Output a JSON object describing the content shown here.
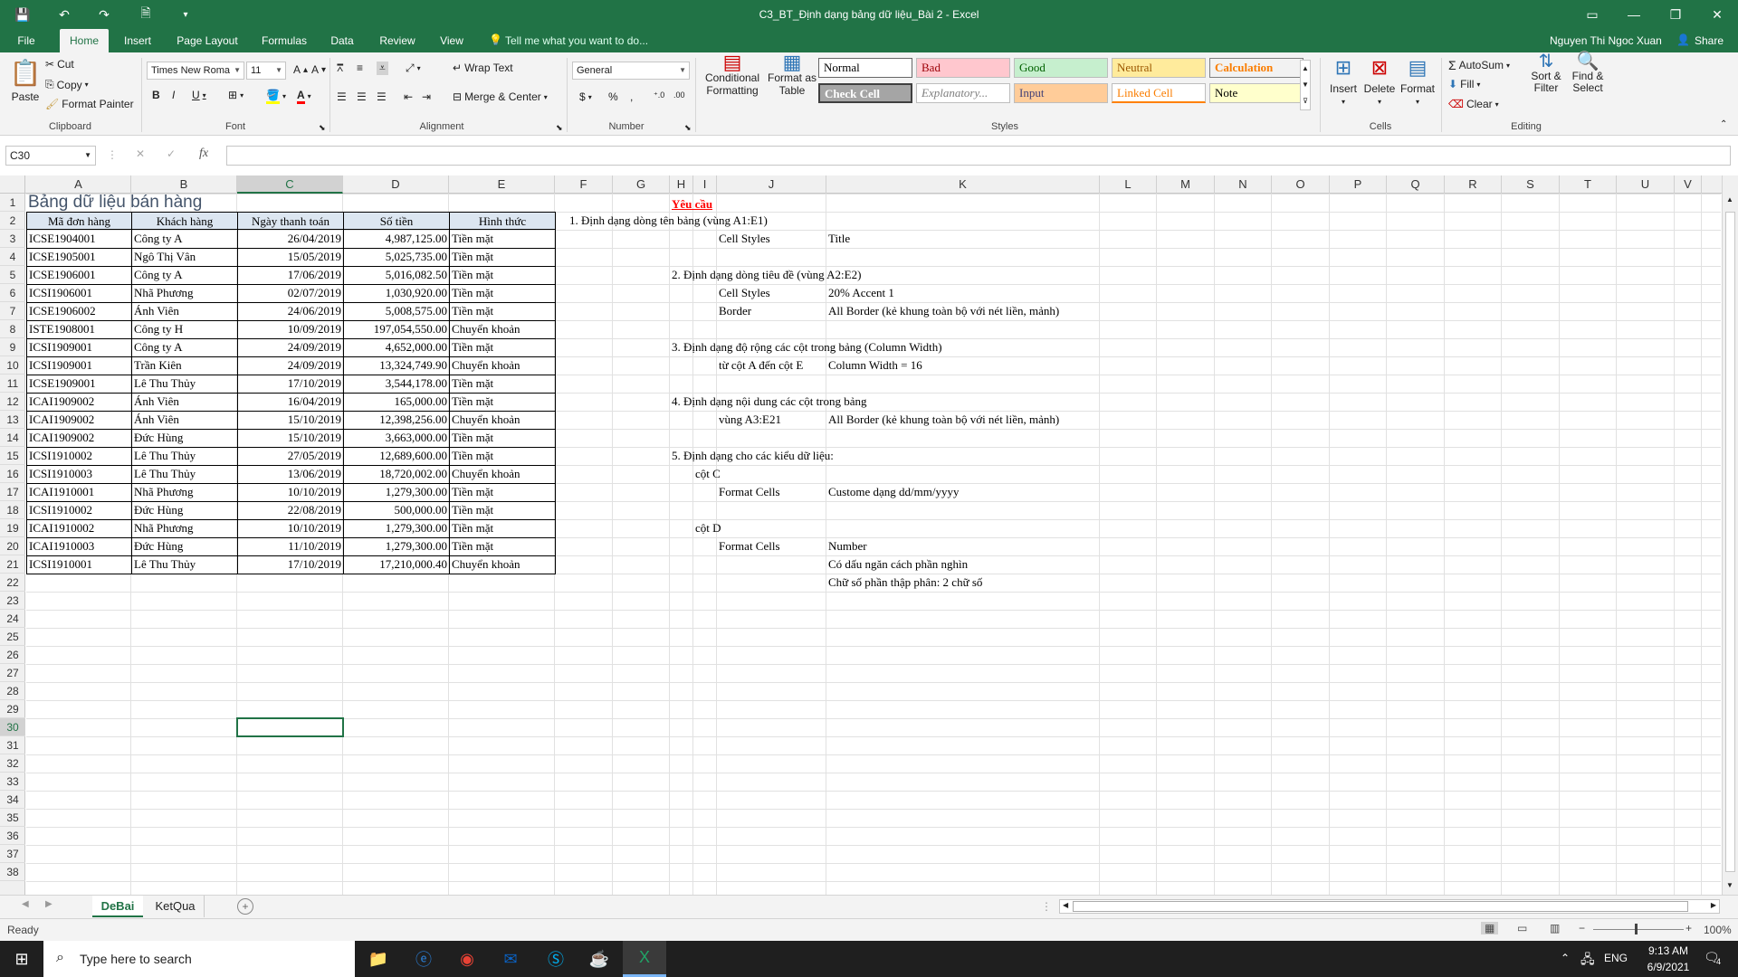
{
  "window": {
    "title": "C3_BT_Định dạng bảng dữ liệu_Bài 2 - Excel",
    "user": "Nguyen Thi Ngoc Xuan",
    "share_label": "Share"
  },
  "ribbon_tabs": [
    "File",
    "Home",
    "Insert",
    "Page Layout",
    "Formulas",
    "Data",
    "Review",
    "View"
  ],
  "tell_me": "Tell me what you want to do...",
  "clipboard": {
    "paste": "Paste",
    "cut": "Cut",
    "copy": "Copy",
    "format_painter": "Format Painter",
    "label": "Clipboard"
  },
  "font": {
    "name": "Times New Roma",
    "size": "11",
    "label": "Font"
  },
  "alignment": {
    "wrap": "Wrap Text",
    "merge": "Merge & Center",
    "label": "Alignment"
  },
  "number": {
    "format": "General",
    "label": "Number"
  },
  "styles": {
    "conditional": "Conditional Formatting",
    "format_table": "Format as Table",
    "label": "Styles",
    "cells": [
      {
        "t": "Normal",
        "bg": "#ffffff",
        "fg": "#000000"
      },
      {
        "t": "Bad",
        "bg": "#ffc7ce",
        "fg": "#9c0006"
      },
      {
        "t": "Good",
        "bg": "#c6efce",
        "fg": "#006100"
      },
      {
        "t": "Neutral",
        "bg": "#ffeb9c",
        "fg": "#9c5700"
      },
      {
        "t": "Calculation",
        "bg": "#f2f2f2",
        "fg": "#fa7d00"
      },
      {
        "t": "Check Cell",
        "bg": "#a5a5a5",
        "fg": "#ffffff"
      },
      {
        "t": "Explanatory...",
        "bg": "#ffffff",
        "fg": "#7f7f7f"
      },
      {
        "t": "Input",
        "bg": "#ffcc99",
        "fg": "#3f3f76"
      },
      {
        "t": "Linked Cell",
        "bg": "#ffffff",
        "fg": "#fa7d00"
      },
      {
        "t": "Note",
        "bg": "#ffffcc",
        "fg": "#000000"
      }
    ]
  },
  "cells_grp": {
    "insert": "Insert",
    "delete": "Delete",
    "format": "Format",
    "label": "Cells"
  },
  "editing": {
    "autosum": "AutoSum",
    "fill": "Fill",
    "clear": "Clear",
    "sort": "Sort & Filter",
    "find": "Find & Select",
    "label": "Editing"
  },
  "namebox": "C30",
  "columns": [
    "A",
    "B",
    "C",
    "D",
    "E",
    "F",
    "G",
    "H",
    "I",
    "J",
    "K",
    "L",
    "M",
    "N",
    "O",
    "P",
    "Q",
    "R",
    "S",
    "T",
    "U",
    "V"
  ],
  "rows": [
    "1",
    "2",
    "3",
    "4",
    "5",
    "6",
    "7",
    "8",
    "9",
    "10",
    "11",
    "12",
    "13",
    "14",
    "15",
    "16",
    "17",
    "18",
    "19",
    "20",
    "21",
    "22",
    "23",
    "24",
    "25",
    "26",
    "27",
    "28",
    "29",
    "30",
    "31",
    "32",
    "33",
    "34",
    "35",
    "36",
    "37",
    "38"
  ],
  "table": {
    "title": "Bảng dữ liệu bán hàng",
    "headers": [
      "Mã đơn hàng",
      "Khách hàng",
      "Ngày thanh toán",
      "Số tiền",
      "Hình thức"
    ],
    "rows": [
      [
        "ICSE1904001",
        "Công ty A",
        "26/04/2019",
        "4,987,125.00",
        "Tiền mặt"
      ],
      [
        "ICSE1905001",
        "Ngô Thị Vân",
        "15/05/2019",
        "5,025,735.00",
        "Tiền mặt"
      ],
      [
        "ICSE1906001",
        "Công ty A",
        "17/06/2019",
        "5,016,082.50",
        "Tiền mặt"
      ],
      [
        "ICSI1906001",
        "Nhã Phương",
        "02/07/2019",
        "1,030,920.00",
        "Tiền mặt"
      ],
      [
        "ICSE1906002",
        "Ánh Viên",
        "24/06/2019",
        "5,008,575.00",
        "Tiền mặt"
      ],
      [
        "ISTE1908001",
        "Công ty H",
        "10/09/2019",
        "197,054,550.00",
        "Chuyển khoản"
      ],
      [
        "ICSI1909001",
        "Công ty A",
        "24/09/2019",
        "4,652,000.00",
        "Tiền mặt"
      ],
      [
        "ICSI1909001",
        "Trần Kiên",
        "24/09/2019",
        "13,324,749.90",
        "Chuyển khoản"
      ],
      [
        "ICSE1909001",
        "Lê Thu Thủy",
        "17/10/2019",
        "3,544,178.00",
        "Tiền mặt"
      ],
      [
        "ICAI1909002",
        "Ánh Viên",
        "16/04/2019",
        "165,000.00",
        "Tiền mặt"
      ],
      [
        "ICAI1909002",
        "Ánh Viên",
        "15/10/2019",
        "12,398,256.00",
        "Chuyển khoản"
      ],
      [
        "ICAI1909002",
        "Đức Hùng",
        "15/10/2019",
        "3,663,000.00",
        "Tiền mặt"
      ],
      [
        "ICSI1910002",
        "Lê Thu Thủy",
        "27/05/2019",
        "12,689,600.00",
        "Tiền mặt"
      ],
      [
        "ICSI1910003",
        "Lê Thu Thủy",
        "13/06/2019",
        "18,720,002.00",
        "Chuyển khoản"
      ],
      [
        "ICAI1910001",
        "Nhã Phương",
        "10/10/2019",
        "1,279,300.00",
        "Tiền mặt"
      ],
      [
        "ICSI1910002",
        "Đức Hùng",
        "22/08/2019",
        "500,000.00",
        "Tiền mặt"
      ],
      [
        "ICAI1910002",
        "Nhã Phương",
        "10/10/2019",
        "1,279,300.00",
        "Tiền mặt"
      ],
      [
        "ICAI1910003",
        "Đức Hùng",
        "11/10/2019",
        "1,279,300.00",
        "Tiền mặt"
      ],
      [
        "ICSI1910001",
        "Lê Thu Thủy",
        "17/10/2019",
        "17,210,000.40",
        "Chuyển khoản"
      ]
    ]
  },
  "requirements": {
    "heading": "Yêu cầu",
    "lines": [
      {
        "row": 2,
        "col": "F",
        "text": "1. Định dạng dòng tên bảng (vùng A1:E1)"
      },
      {
        "row": 3,
        "col": "J",
        "text": "Cell Styles"
      },
      {
        "row": 3,
        "col": "K",
        "text": "Title"
      },
      {
        "row": 5,
        "col": "H",
        "text": "2. Định dạng dòng tiêu đề (vùng A2:E2)"
      },
      {
        "row": 6,
        "col": "J",
        "text": "Cell Styles"
      },
      {
        "row": 6,
        "col": "K",
        "text": "20% Accent 1"
      },
      {
        "row": 7,
        "col": "J",
        "text": "Border"
      },
      {
        "row": 7,
        "col": "K",
        "text": "All Border (kẻ khung toàn bộ với nét liền, mảnh)"
      },
      {
        "row": 9,
        "col": "H",
        "text": "3. Định dạng độ rộng các cột trong bảng (Column Width)"
      },
      {
        "row": 10,
        "col": "J",
        "text": "từ cột A đến cột E"
      },
      {
        "row": 10,
        "col": "K",
        "text": "Column Width = 16"
      },
      {
        "row": 12,
        "col": "H",
        "text": "4. Định dạng nội dung các cột trong bảng"
      },
      {
        "row": 13,
        "col": "J",
        "text": "vùng A3:E21"
      },
      {
        "row": 13,
        "col": "K",
        "text": "All Border (kẻ khung toàn bộ với nét liền, mảnh)"
      },
      {
        "row": 15,
        "col": "H",
        "text": "5. Định dạng cho các kiểu dữ liệu:"
      },
      {
        "row": 16,
        "col": "I",
        "text": "cột C"
      },
      {
        "row": 17,
        "col": "J",
        "text": "Format Cells"
      },
      {
        "row": 17,
        "col": "K",
        "text": "Custome dạng dd/mm/yyyy"
      },
      {
        "row": 19,
        "col": "I",
        "text": "cột D"
      },
      {
        "row": 20,
        "col": "J",
        "text": "Format Cells"
      },
      {
        "row": 20,
        "col": "K",
        "text": "Number"
      },
      {
        "row": 21,
        "col": "K",
        "text": "Có dấu ngăn cách phần nghìn"
      },
      {
        "row": 22,
        "col": "K",
        "text": "Chữ số phần thập phân: 2 chữ số"
      }
    ]
  },
  "sheets": [
    "DeBai",
    "KetQua"
  ],
  "status": {
    "ready": "Ready",
    "zoom": "100%"
  },
  "taskbar": {
    "search": "Type here to search",
    "lang": "ENG",
    "time": "9:13 AM",
    "date": "6/9/2021",
    "notif": "4"
  }
}
